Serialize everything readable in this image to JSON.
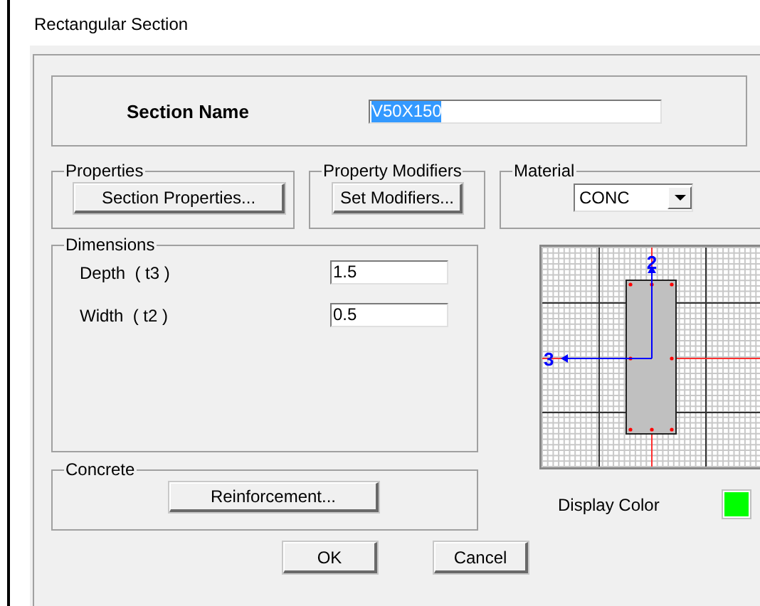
{
  "window": {
    "title": "Rectangular Section"
  },
  "section_name": {
    "label": "Section Name",
    "value": "V50X150",
    "selected": true
  },
  "properties": {
    "title": "Properties",
    "button": "Section Properties..."
  },
  "property_modifiers": {
    "title": "Property Modifiers",
    "button": "Set Modifiers..."
  },
  "material": {
    "title": "Material",
    "value": "CONC"
  },
  "dimensions": {
    "title": "Dimensions",
    "fields": [
      {
        "label": "Depth  ( t3 )",
        "value": "1.5"
      },
      {
        "label": "Width  ( t2 )",
        "value": "0.5"
      }
    ]
  },
  "concrete": {
    "title": "Concrete",
    "button": "Reinforcement..."
  },
  "preview": {
    "axes": [
      {
        "label": "2"
      },
      {
        "label": "3"
      }
    ]
  },
  "display_color": {
    "label": "Display Color",
    "color": "#00ff00"
  },
  "buttons": [
    "OK",
    "Cancel"
  ]
}
